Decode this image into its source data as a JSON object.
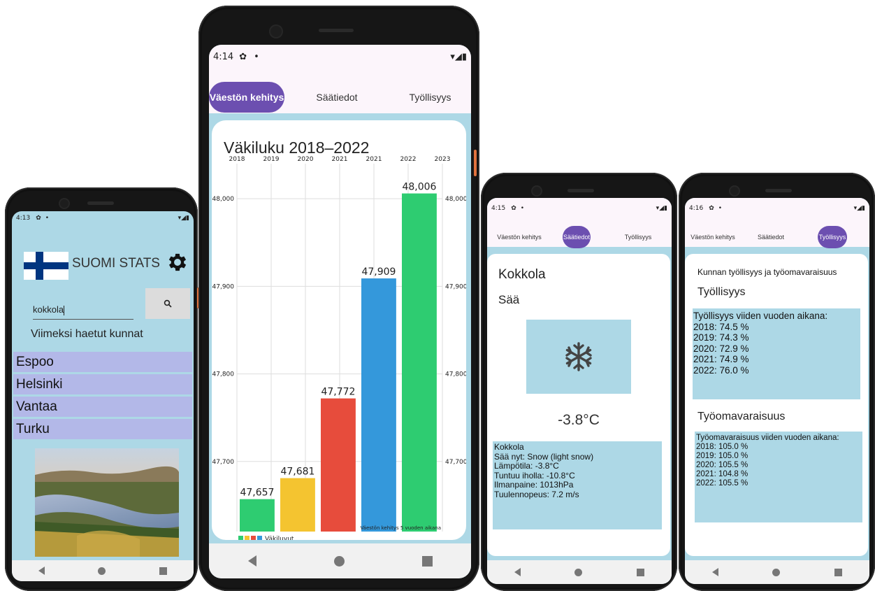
{
  "phone1": {
    "status_time": "4:13",
    "app_title": "SUOMI STATS",
    "search_value": "kokkola",
    "recent_heading": "Viimeksi haetut kunnat",
    "recent_items": [
      "Espoo",
      "Helsinki",
      "Vantaa",
      "Turku"
    ]
  },
  "phone2": {
    "status_time": "4:14",
    "tabs": [
      "Väestön kehitys",
      "Säätiedot",
      "Työllisyys"
    ],
    "chart_data": {
      "type": "bar",
      "title": "Väkiluku 2018–2022",
      "top_ticks": [
        "2018",
        "2019",
        "2020",
        "2021",
        "2021",
        "2022",
        "2023"
      ],
      "categories": [
        "2018",
        "2019",
        "2020",
        "2021",
        "2022"
      ],
      "values": [
        47657,
        47681,
        47772,
        47909,
        48006
      ],
      "value_labels": [
        "47,657",
        "47,681",
        "47,772",
        "47,909",
        "48,006"
      ],
      "colors": [
        "#2ecc71",
        "#f4c430",
        "#e74c3c",
        "#3498db",
        "#2ecc71"
      ],
      "ylim": [
        47620,
        48040
      ],
      "y_ticks": [
        47700,
        47800,
        47900,
        48000
      ],
      "y_tick_labels": [
        "47,700",
        "47,800",
        "47,900",
        "48,000"
      ],
      "legend_label": "Väkiluvut",
      "description_label": "Väestön kehitys 5 vuoden aikana",
      "grid": true
    }
  },
  "phone3": {
    "status_time": "4:15",
    "tabs": [
      "Väestön kehitys",
      "Säätiedot",
      "Työllisyys"
    ],
    "city": "Kokkola",
    "weather_heading": "Sää",
    "temperature": "-3.8°C",
    "details": [
      "Kokkola",
      "Sää nyt: Snow (light snow)",
      "Lämpötila: -3.8°C",
      "Tuntuu iholla: -10.8°C",
      "Ilmanpaine: 1013hPa",
      "Tuulennopeus: 7.2 m/s"
    ]
  },
  "phone4": {
    "status_time": "4:16",
    "tabs": [
      "Väestön kehitys",
      "Säätiedot",
      "Työllisyys"
    ],
    "intro": "Kunnan työllisyys ja työomavaraisuus",
    "employment_heading": "Työllisyys",
    "employment_lines": [
      "Työllisyys viiden vuoden aikana:",
      "2018: 74.5 %",
      "2019: 74.3 %",
      "2020: 72.9 %",
      "2021: 74.9 %",
      "2022: 76.0 %"
    ],
    "selfsufficiency_heading": "Työomavaraisuus",
    "selfsufficiency_lines": [
      "Työomavaraisuus viiden vuoden aikana:",
      "2018: 105.0 %",
      "2019: 105.0 %",
      "2020: 105.5 %",
      "2021: 104.8 %",
      "2022: 105.5 %"
    ]
  }
}
